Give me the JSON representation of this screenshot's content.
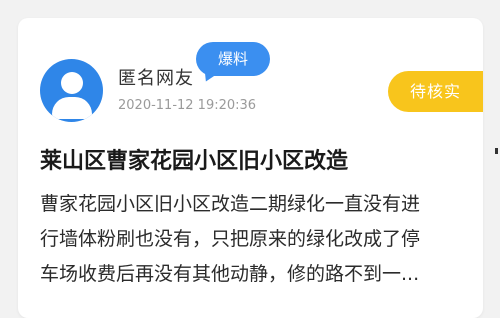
{
  "post": {
    "author": "匿名网友",
    "date": "2020-11-12 19:20:36",
    "tag": "爆料",
    "status": "待核实",
    "title": "莱山区曹家花园小区旧小区改造",
    "content_lines": [
      "曹家花园小区旧小区改造二期绿化一直没有进",
      "行墙体粉刷也没有，只把原来的绿化改成了停",
      "车场收费后再没有其他动静，修的路不到一..."
    ]
  },
  "colors": {
    "avatar": "#2f86e8",
    "tag": "#3b8ff0",
    "status": "#f8c51c",
    "background": "#f2f2f2"
  },
  "icons": {
    "avatar": "user-icon"
  }
}
